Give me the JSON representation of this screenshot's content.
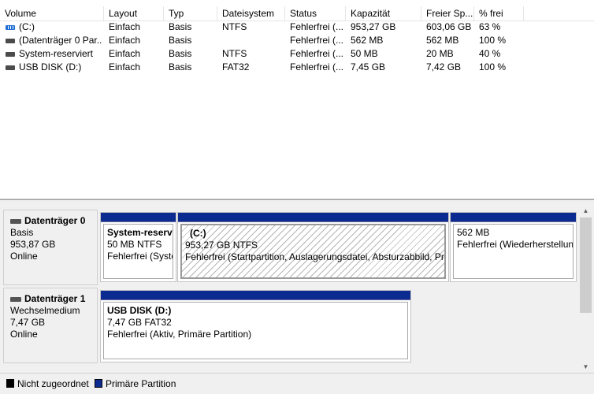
{
  "list": {
    "columns": [
      "Volume",
      "Layout",
      "Typ",
      "Dateisystem",
      "Status",
      "Kapazität",
      "Freier Sp...",
      "% frei"
    ],
    "rows": [
      {
        "volume": "(C:)",
        "icon": "striped-volume-icon",
        "layout": "Einfach",
        "typ": "Basis",
        "fs": "NTFS",
        "status": "Fehlerfrei (...",
        "capacity": "953,27 GB",
        "free": "603,06 GB",
        "pct": "63 %"
      },
      {
        "volume": "(Datenträger 0 Par...",
        "icon": "volume-icon",
        "layout": "Einfach",
        "typ": "Basis",
        "fs": "",
        "status": "Fehlerfrei (...",
        "capacity": "562 MB",
        "free": "562 MB",
        "pct": "100 %"
      },
      {
        "volume": "System-reserviert",
        "icon": "volume-icon",
        "layout": "Einfach",
        "typ": "Basis",
        "fs": "NTFS",
        "status": "Fehlerfrei (...",
        "capacity": "50 MB",
        "free": "20 MB",
        "pct": "40 %"
      },
      {
        "volume": "USB DISK (D:)",
        "icon": "volume-icon",
        "layout": "Einfach",
        "typ": "Basis",
        "fs": "FAT32",
        "status": "Fehlerfrei (...",
        "capacity": "7,45 GB",
        "free": "7,42 GB",
        "pct": "100 %"
      }
    ]
  },
  "disks": [
    {
      "title": "Datenträger 0",
      "type": "Basis",
      "size": "953,87 GB",
      "state": "Online",
      "partitions": [
        {
          "name": "System-reserv",
          "size": "50 MB NTFS",
          "status": "Fehlerfrei (Syste"
        },
        {
          "name": "(C:)",
          "size": "953,27 GB NTFS",
          "status": "Fehlerfrei (Startpartition, Auslagerungsdatei, Absturzabbild, Pri"
        },
        {
          "name": "",
          "size": "562 MB",
          "status": "Fehlerfrei (Wiederherstellun"
        }
      ]
    },
    {
      "title": "Datenträger 1",
      "type": "Wechselmedium",
      "size": "7,47 GB",
      "state": "Online",
      "partitions": [
        {
          "name": "USB DISK  (D:)",
          "size": "7,47 GB FAT32",
          "status": "Fehlerfrei (Aktiv, Primäre Partition)"
        }
      ]
    }
  ],
  "legend": [
    {
      "label": "Nicht zugeordnet",
      "color": "#000000"
    },
    {
      "label": "Primäre Partition",
      "color": "#0c2b91"
    }
  ]
}
